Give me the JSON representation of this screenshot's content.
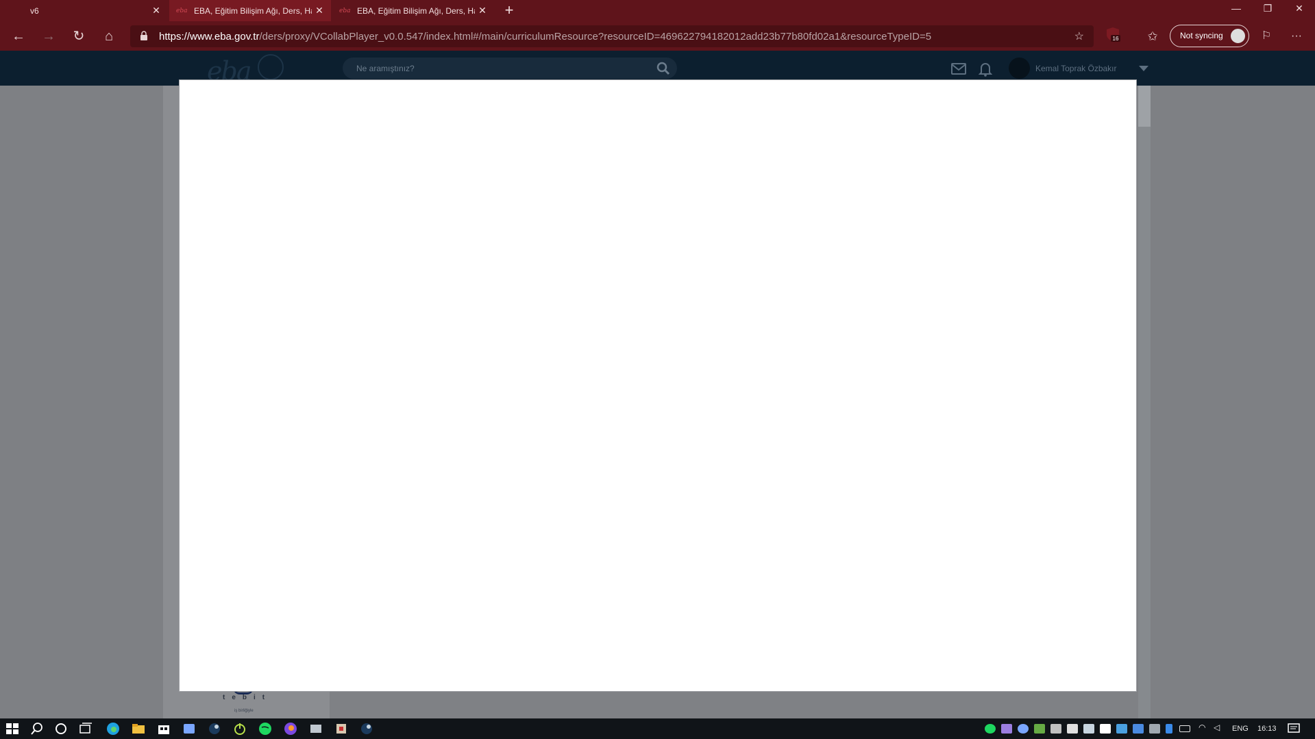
{
  "browser": {
    "tabs": [
      {
        "title": "v6"
      },
      {
        "title": "EBA, Eğitim Bilişim Ağı, Ders, Hal",
        "favicon": "eba"
      },
      {
        "title": "EBA, Eğitim Bilişim Ağı, Ders, Hal",
        "favicon": "eba"
      }
    ],
    "new_tab": "+",
    "url_host": "https://www.eba.gov.tr",
    "url_path": "/ders/proxy/VCollabPlayer_v0.0.547/index.html#/main/curriculumResource?resourceID=469622794182012add23b77b80fd02a1&resourceTypeID=5",
    "extension_badge": "16",
    "sync_label": "Not syncing",
    "accent_color": "#5f141b"
  },
  "eba": {
    "logo": "eba",
    "search_placeholder": "Ne aramıştınız?",
    "user_name": "Kemal Toprak Özbakır",
    "left_logo": "tebit",
    "left_logo_sub": "iş birliğiyle"
  },
  "taskbar": {
    "lang": "ENG",
    "time": "16:13",
    "apps": [
      "start-icon",
      "search-icon",
      "cortana-icon",
      "task-view-icon",
      "edge-icon",
      "file-explorer-icon",
      "store-icon",
      "app-icon",
      "steam-icon",
      "power-icon",
      "spotify-icon",
      "firefox-icon",
      "app-icon",
      "app-icon",
      "steam-icon"
    ]
  }
}
